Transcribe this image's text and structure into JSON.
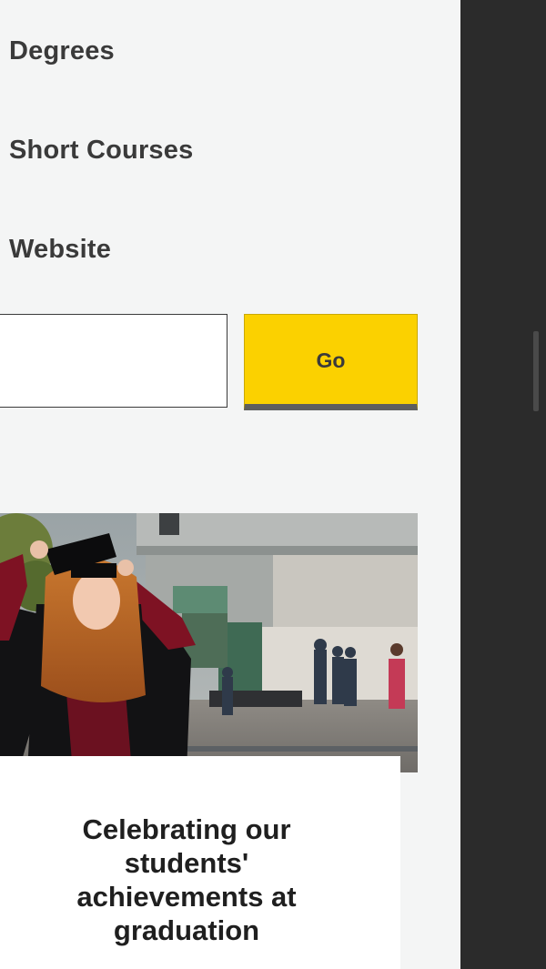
{
  "nav": {
    "items": [
      {
        "label": "Degrees"
      },
      {
        "label": "Short Courses"
      },
      {
        "label": "Website"
      }
    ]
  },
  "search": {
    "value": "",
    "placeholder": "",
    "go_label": "Go",
    "go_color": "#fbd100"
  },
  "feature": {
    "image_icon": "graduation-photo",
    "title": "Celebrating our students' achievements at graduation"
  },
  "colors": {
    "panel_bg": "#f4f5f5",
    "rail_bg": "#2b2b2b",
    "accent": "#fbd100",
    "text": "#3a3a3a"
  }
}
